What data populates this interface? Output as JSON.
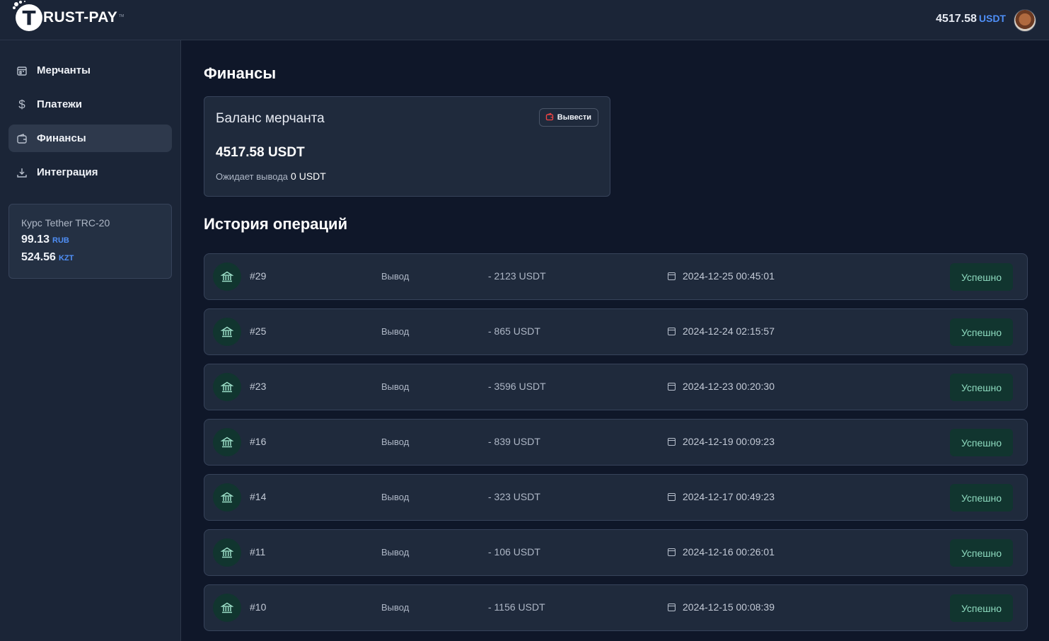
{
  "brand": {
    "logo_letter": "T",
    "name": "RUST-PAY",
    "sup": "TM"
  },
  "header": {
    "balance_amount": "4517.58",
    "balance_currency": "USDT"
  },
  "sidebar": {
    "items": [
      {
        "label": "Мерчанты",
        "icon": "store-icon",
        "active": false
      },
      {
        "label": "Платежи",
        "icon": "dollar-icon",
        "active": false
      },
      {
        "label": "Финансы",
        "icon": "wallet-icon",
        "active": true
      },
      {
        "label": "Интеграция",
        "icon": "download-icon",
        "active": false
      }
    ],
    "rate_card": {
      "title": "Курс Tether TRC-20",
      "rub_value": "99.13",
      "rub_label": "RUB",
      "kzt_value": "524.56",
      "kzt_label": "KZT"
    }
  },
  "main": {
    "title": "Финансы",
    "balance_card": {
      "title": "Баланс мерчанта",
      "withdraw_label": "Вывести",
      "amount": "4517.58 USDT",
      "pending_label": "Ожидает вывода",
      "pending_value": "0 USDT"
    },
    "history_title": "История операций",
    "operations": [
      {
        "id": "#29",
        "type": "Вывод",
        "amount": "- 2123 USDT",
        "date": "2024-12-25 00:45:01",
        "status": "Успешно"
      },
      {
        "id": "#25",
        "type": "Вывод",
        "amount": "- 865 USDT",
        "date": "2024-12-24 02:15:57",
        "status": "Успешно"
      },
      {
        "id": "#23",
        "type": "Вывод",
        "amount": "- 3596 USDT",
        "date": "2024-12-23 00:20:30",
        "status": "Успешно"
      },
      {
        "id": "#16",
        "type": "Вывод",
        "amount": "- 839 USDT",
        "date": "2024-12-19 00:09:23",
        "status": "Успешно"
      },
      {
        "id": "#14",
        "type": "Вывод",
        "amount": "- 323 USDT",
        "date": "2024-12-17 00:49:23",
        "status": "Успешно"
      },
      {
        "id": "#11",
        "type": "Вывод",
        "amount": "- 106 USDT",
        "date": "2024-12-16 00:26:01",
        "status": "Успешно"
      },
      {
        "id": "#10",
        "type": "Вывод",
        "amount": "- 1156 USDT",
        "date": "2024-12-15 00:08:39",
        "status": "Успешно"
      }
    ]
  },
  "colors": {
    "accent": "#4f8ff7",
    "success_bg": "#11352f",
    "success_text": "#8fdcc0",
    "danger": "#ef4444"
  }
}
